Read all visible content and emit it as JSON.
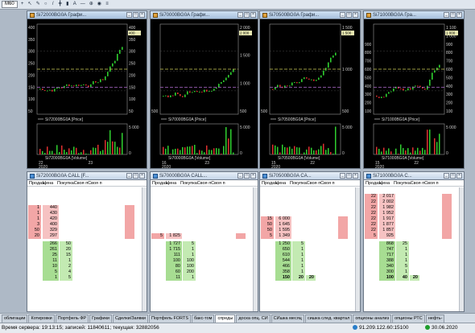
{
  "toolbar": {
    "period": "M60",
    "buttons": [
      {
        "name": "crosshair",
        "glyph": "+"
      },
      {
        "name": "cursor",
        "glyph": "↖"
      },
      {
        "name": "pencil",
        "glyph": "✎"
      },
      {
        "name": "circle",
        "glyph": "○"
      },
      {
        "name": "line",
        "glyph": "/"
      },
      {
        "name": "cross-line",
        "glyph": "╋"
      },
      {
        "name": "marker",
        "glyph": "▮"
      },
      {
        "name": "text",
        "glyph": "A"
      },
      {
        "name": "hline",
        "glyph": "—"
      },
      {
        "name": "zoom",
        "glyph": "⊕"
      },
      {
        "name": "eye",
        "glyph": "◉"
      },
      {
        "name": "lines",
        "glyph": "≡"
      }
    ]
  },
  "charts": [
    {
      "title": "Si72000BG0A Графи...",
      "price_label": "Si72000BG0A [Price]",
      "volume_label": "Si72000BG0A [Volume]",
      "price_ticks": [
        "400",
        "350",
        "300",
        "250",
        "200",
        "150",
        "100",
        "50"
      ],
      "vol_ticks": [
        "5 000",
        "0"
      ],
      "date_ticks": [
        "22",
        "23"
      ],
      "year": "2020",
      "last_price": "400"
    },
    {
      "title": "Si70000BG0A Графи...",
      "price_label": "Si70000BG0A [Price]",
      "volume_label": "Si70000BG0A [Volume]",
      "price_ticks": [
        "2 000",
        "1 500",
        "1 000",
        "500"
      ],
      "vol_ticks": [
        "5 000",
        "0"
      ],
      "date_ticks": [
        "16",
        "23"
      ],
      "year": "2020",
      "last_price": "2 000"
    },
    {
      "title": "Si70500BG0A Графи...",
      "price_label": "Si70500BG0A [Price]",
      "volume_label": "Si70500BG0A [Volume]",
      "price_ticks": [
        "1 500",
        "1 000",
        "500"
      ],
      "vol_ticks": [
        "5 000",
        "0"
      ],
      "date_ticks": [
        "15",
        "22"
      ],
      "year": "2020",
      "last_price": "1 500"
    },
    {
      "title": "Si71000BG0A Гра...",
      "price_label": "Si71000BG0A [Price]",
      "volume_label": "Si71000BG0A [Volume]",
      "price_ticks": [
        "1 100",
        "1 000",
        "900",
        "800",
        "700",
        "600",
        "500",
        "400",
        "300",
        "200",
        "100"
      ],
      "vol_ticks": [
        "5 000",
        "0"
      ],
      "date_ticks": [
        "15",
        "22"
      ],
      "year": "2020",
      "last_price": "1 000"
    }
  ],
  "books": [
    {
      "title": "Si72000BG0A CALL [F...",
      "headers": [
        "Продаж",
        "Цена",
        "ПокупкаСвоя пСвоя п"
      ],
      "asks": [
        {
          "qty": "1",
          "price": "440"
        },
        {
          "qty": "1",
          "price": "430"
        },
        {
          "qty": "1",
          "price": "420"
        },
        {
          "qty": "3",
          "price": "400"
        },
        {
          "qty": "50",
          "price": "329"
        },
        {
          "qty": "20",
          "price": "297"
        }
      ],
      "bids": [
        {
          "price": "266",
          "qty": "50"
        },
        {
          "price": "261",
          "qty": "20"
        },
        {
          "price": "25",
          "qty": "15"
        },
        {
          "price": "11",
          "qty": "1"
        },
        {
          "price": "10",
          "qty": "2"
        },
        {
          "price": "5",
          "qty": "4"
        },
        {
          "price": "1",
          "qty": "5"
        }
      ]
    },
    {
      "title": "Si70000BG0A CALL...",
      "headers": [
        "Продаж",
        "Цена",
        "ПокупкаСвоя пСвоя п"
      ],
      "asks": [
        {
          "qty": "5",
          "price": "1 825"
        }
      ],
      "bids": [
        {
          "price": "1 727",
          "qty": "5"
        },
        {
          "price": "1 715",
          "qty": "1"
        },
        {
          "price": "111",
          "qty": "1"
        },
        {
          "price": "100",
          "qty": "100"
        },
        {
          "price": "80",
          "qty": "100"
        },
        {
          "price": "60",
          "qty": "200"
        },
        {
          "price": "11",
          "qty": "1"
        }
      ]
    },
    {
      "title": "Si70500BG0A CA...",
      "headers": [
        "Продаж",
        "Цена",
        "ПокупкаСвоя пСвоя п"
      ],
      "asks": [
        {
          "qty": "15",
          "price": "6 000"
        },
        {
          "qty": "50",
          "price": "1 645"
        },
        {
          "qty": "50",
          "price": "1 595"
        },
        {
          "qty": "5",
          "price": "1 349"
        }
      ],
      "bids": [
        {
          "price": "1 250",
          "qty": "5"
        },
        {
          "price": "650",
          "qty": "1"
        },
        {
          "price": "610",
          "qty": "1"
        },
        {
          "price": "544",
          "qty": "1"
        },
        {
          "price": "466",
          "qty": "1"
        },
        {
          "price": "358",
          "qty": "1"
        },
        {
          "price": "150",
          "qty": "20"
        }
      ],
      "bid_extra": "20"
    },
    {
      "title": "Si71000BG0A C...",
      "headers": [
        "Продаж",
        "Цена",
        "ПокупкаСвоя пСвоя п"
      ],
      "asks": [
        {
          "qty": "22",
          "price": "2 017"
        },
        {
          "qty": "22",
          "price": "2 002"
        },
        {
          "qty": "22",
          "price": "1 982"
        },
        {
          "qty": "22",
          "price": "1 952"
        },
        {
          "qty": "22",
          "price": "1 917"
        },
        {
          "qty": "22",
          "price": "1 877"
        },
        {
          "qty": "22",
          "price": "1 857"
        },
        {
          "qty": "5",
          "price": "925"
        }
      ],
      "bids": [
        {
          "price": "868",
          "qty": "25"
        },
        {
          "price": "747",
          "qty": "1"
        },
        {
          "price": "717",
          "qty": "1"
        },
        {
          "price": "388",
          "qty": "1"
        },
        {
          "price": "340",
          "qty": "5"
        },
        {
          "price": "300",
          "qty": "1"
        },
        {
          "price": "100",
          "qty": "40"
        }
      ],
      "bid_extra": "20"
    }
  ],
  "tabs": [
    "облигации",
    "Котировки",
    "Портфель ФР",
    "Графики",
    "Сделки/Заявки",
    "Портфель FORTS",
    "бакс-том",
    "спреды",
    "доска опц. СИ",
    "СИшка месяц",
    "сишка след. квартал",
    "опционы анализ",
    "опционы РТС",
    "нефть-"
  ],
  "active_tab": 7,
  "status": {
    "left": "Время сервера: 19:13:15; записей: 11840611; текущая: 32882056",
    "server": "91.209.122.60:15100",
    "date": "30.06.2020"
  }
}
